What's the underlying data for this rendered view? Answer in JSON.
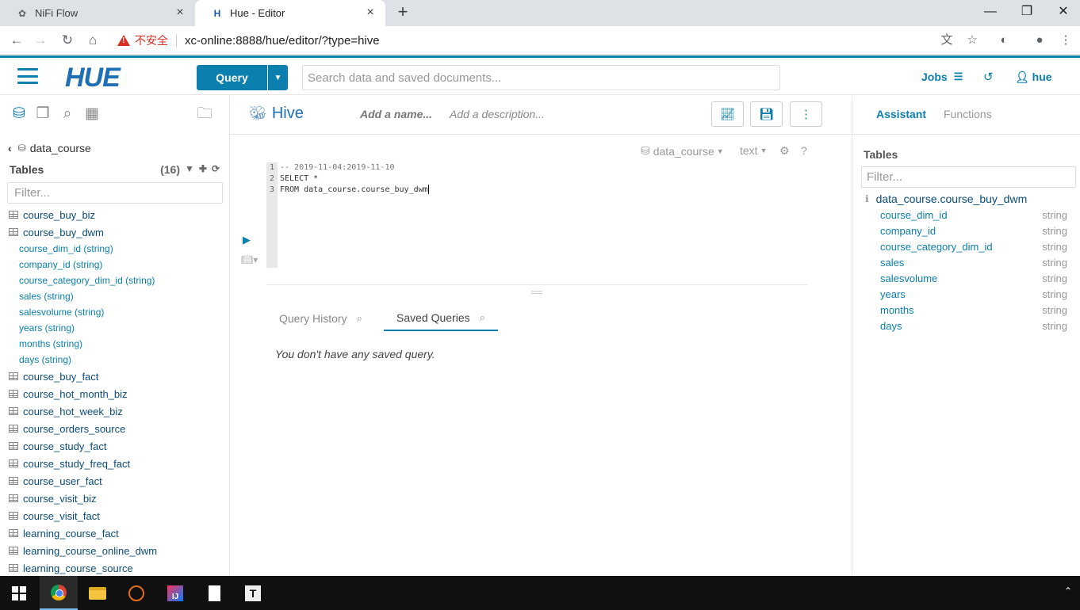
{
  "browser": {
    "tabs": [
      {
        "title": "NiFi Flow",
        "active": false
      },
      {
        "title": "Hue - Editor",
        "active": true
      }
    ],
    "new_tab": "+",
    "window_controls": {
      "minimize": "—",
      "restore": "❐",
      "close": "✕"
    },
    "security_warning": "不安全",
    "url": "xc-online:8888/hue/editor/?type=hive"
  },
  "hue": {
    "logo": "HUE",
    "query_button": "Query",
    "search_placeholder": "Search data and saved documents...",
    "jobs": "Jobs",
    "user": "hue"
  },
  "left": {
    "database": "data_course",
    "tables_label": "Tables",
    "tables_count": "(16)",
    "filter_placeholder": "Filter...",
    "tables": [
      {
        "name": "course_buy_biz"
      },
      {
        "name": "course_buy_dwm",
        "columns": [
          "course_dim_id (string)",
          "company_id (string)",
          "course_category_dim_id (string)",
          "sales (string)",
          "salesvolume (string)",
          "years (string)",
          "months (string)",
          "days (string)"
        ]
      },
      {
        "name": "course_buy_fact"
      },
      {
        "name": "course_hot_month_biz"
      },
      {
        "name": "course_hot_week_biz"
      },
      {
        "name": "course_orders_source"
      },
      {
        "name": "course_study_fact"
      },
      {
        "name": "course_study_freq_fact"
      },
      {
        "name": "course_user_fact"
      },
      {
        "name": "course_visit_biz"
      },
      {
        "name": "course_visit_fact"
      },
      {
        "name": "learning_course_fact"
      },
      {
        "name": "learning_course_online_dwm"
      },
      {
        "name": "learning_course_source"
      }
    ]
  },
  "editor": {
    "dialect": "Hive",
    "name_placeholder": "Add a name...",
    "description_placeholder": "Add a description...",
    "context_db": "data_course",
    "context_format": "text",
    "help": "?",
    "code_lines": [
      {
        "n": "1",
        "text": "-- 2019-11-04:2019-11-10",
        "type": "comment"
      },
      {
        "n": "2",
        "text": "SELECT *",
        "type": "code"
      },
      {
        "n": "3",
        "text": "FROM data_course.course_buy_dwm",
        "type": "code"
      }
    ],
    "tabs": [
      {
        "label": "Query History",
        "active": false
      },
      {
        "label": "Saved Queries",
        "active": true
      }
    ],
    "empty_message": "You don't have any saved query."
  },
  "assistant": {
    "tabs": [
      {
        "label": "Assistant",
        "active": true
      },
      {
        "label": "Functions",
        "active": false
      }
    ],
    "tables_label": "Tables",
    "filter_placeholder": "Filter...",
    "table": "data_course.course_buy_dwm",
    "columns": [
      {
        "name": "course_dim_id",
        "type": "string"
      },
      {
        "name": "company_id",
        "type": "string"
      },
      {
        "name": "course_category_dim_id",
        "type": "string"
      },
      {
        "name": "sales",
        "type": "string"
      },
      {
        "name": "salesvolume",
        "type": "string"
      },
      {
        "name": "years",
        "type": "string"
      },
      {
        "name": "months",
        "type": "string"
      },
      {
        "name": "days",
        "type": "string"
      }
    ]
  },
  "colors": {
    "hue_blue": "#0b7fad",
    "warning_red": "#d93025",
    "taskbar": "#101010"
  }
}
